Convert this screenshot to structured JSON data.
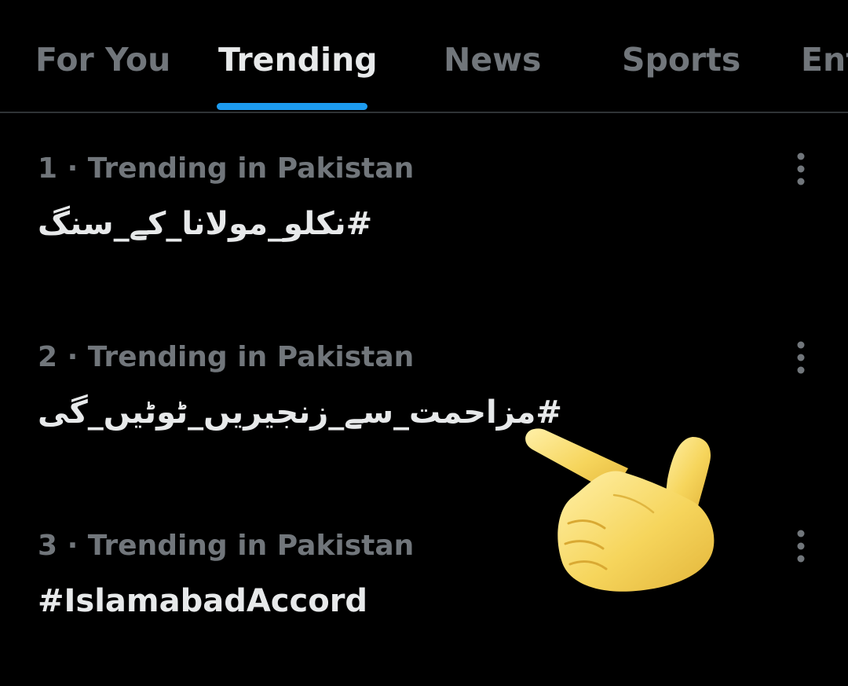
{
  "tabs": [
    {
      "label": "For You",
      "active": false
    },
    {
      "label": "Trending",
      "active": true
    },
    {
      "label": "News",
      "active": false
    },
    {
      "label": "Sports",
      "active": false
    },
    {
      "label": "Ent",
      "active": false
    }
  ],
  "trends": [
    {
      "meta": "1 · Trending in Pakistan",
      "name": "#نکلو_مولانا_کے_سنگ"
    },
    {
      "meta": "2 · Trending in Pakistan",
      "name": "#مزاحمت_سے_زنجیریں_ٹوٹیں_گی"
    },
    {
      "meta": "3 · Trending in Pakistan",
      "name": "#IslamabadAccord"
    }
  ],
  "colors": {
    "background": "#000000",
    "primary_text": "#e7e9ea",
    "secondary_text": "#71767b",
    "accent": "#1d9bf0",
    "divider": "#2f3336"
  },
  "icons": {
    "more": "vertical-ellipsis-icon",
    "pointer": "pointing-hand-emoji"
  }
}
